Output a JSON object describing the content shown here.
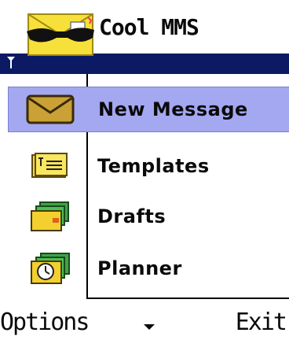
{
  "app": {
    "title": "Cool MMS",
    "logo_icon": "sunglasses-envelope-logo",
    "status_icon": "signal-antenna-icon",
    "title_bar_color": "#0b1a63"
  },
  "menu": {
    "selected_color": "#a4a8f0",
    "items": [
      {
        "label": "New Message",
        "icon": "envelope-icon",
        "selected": true
      },
      {
        "label": "Templates",
        "icon": "template-icon",
        "selected": false
      },
      {
        "label": "Drafts",
        "icon": "drafts-folder-icon",
        "selected": false
      },
      {
        "label": "Planner",
        "icon": "clock-planner-icon",
        "selected": false
      }
    ]
  },
  "softkeys": {
    "left_label": "Options",
    "right_label": "Exit",
    "middle_icon": "down-arrow-icon"
  }
}
